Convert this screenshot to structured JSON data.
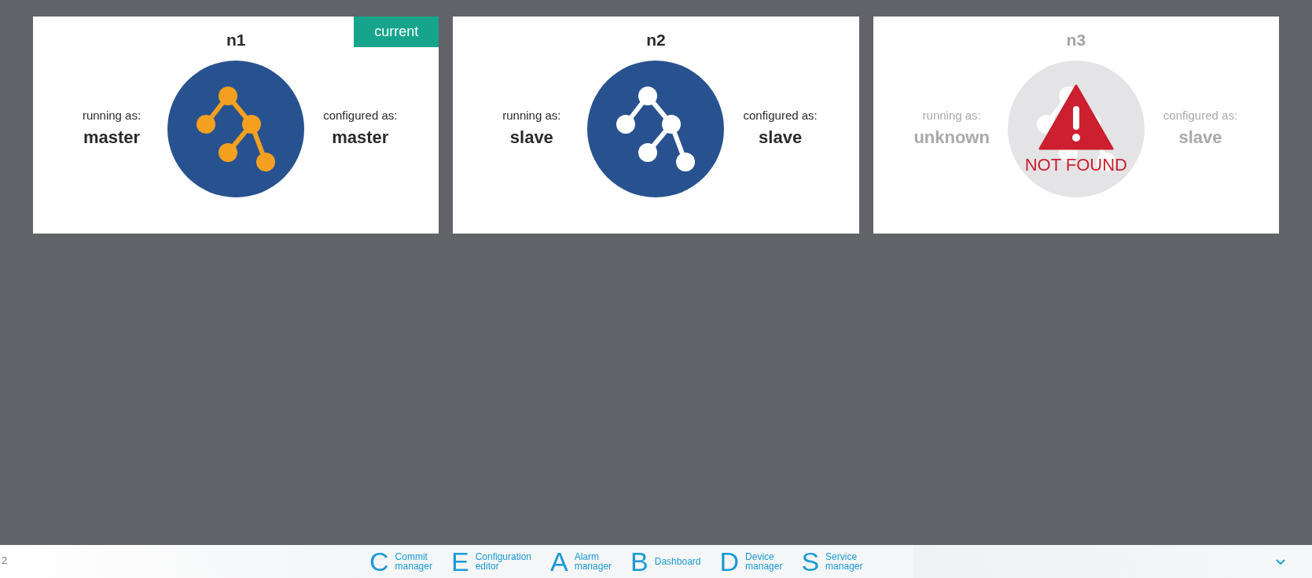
{
  "nodes": [
    {
      "name": "n1",
      "kind": "master",
      "badge": "current",
      "running_label": "running as:",
      "running_value": "master",
      "configured_label": "configured as:",
      "configured_value": "master"
    },
    {
      "name": "n2",
      "kind": "slave",
      "running_label": "running as:",
      "running_value": "slave",
      "configured_label": "configured as:",
      "configured_value": "slave"
    },
    {
      "name": "n3",
      "kind": "missing",
      "alert": "NOT FOUND",
      "running_label": "running as:",
      "running_value": "unknown",
      "configured_label": "configured as:",
      "configured_value": "slave"
    }
  ],
  "dock": {
    "page": "2",
    "apps": [
      {
        "letter": "C",
        "label": "Commit\nmanager"
      },
      {
        "letter": "E",
        "label": "Configuration\neditor"
      },
      {
        "letter": "A",
        "label": "Alarm\nmanager"
      },
      {
        "letter": "B",
        "label": "Dashboard"
      },
      {
        "letter": "D",
        "label": "Device\nmanager"
      },
      {
        "letter": "S",
        "label": "Service\nmanager"
      }
    ]
  }
}
